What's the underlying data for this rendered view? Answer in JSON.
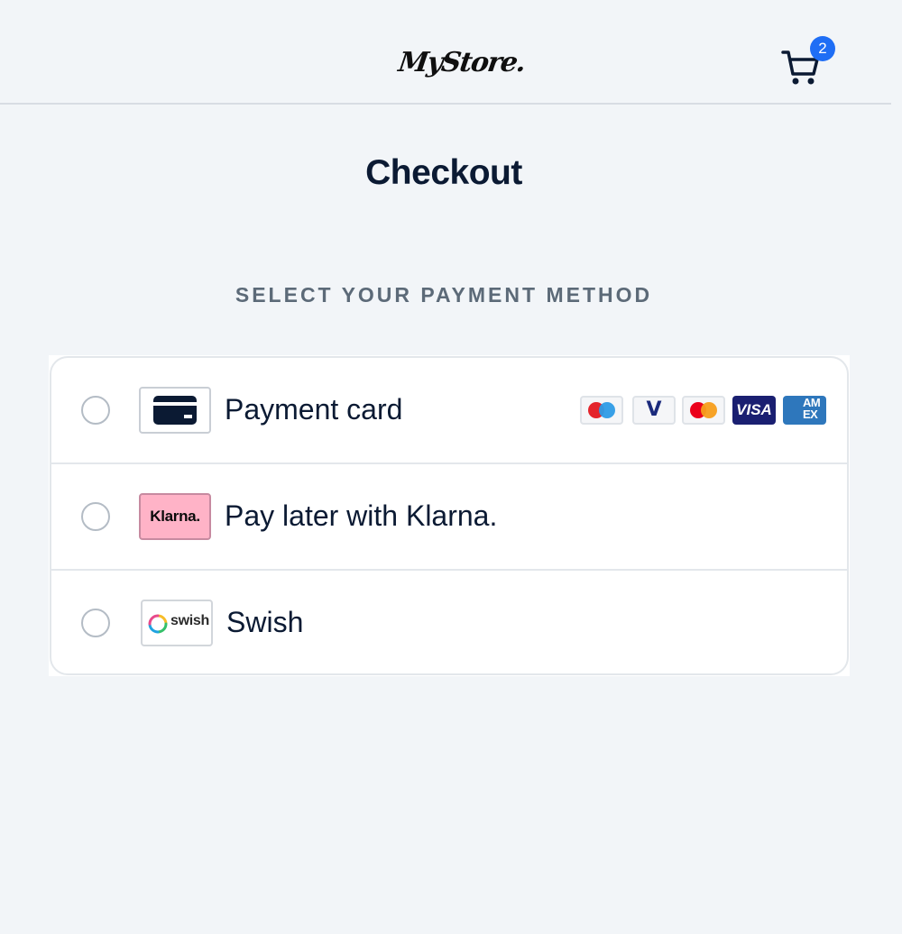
{
  "header": {
    "logo_text": "MyStore.",
    "cart": {
      "icon": "cart-icon",
      "count": "2"
    }
  },
  "page": {
    "title": "Checkout",
    "section_heading": "SELECT YOUR PAYMENT METHOD"
  },
  "payment_methods": [
    {
      "label": "Payment card",
      "icon": "credit-card-icon",
      "selected": false,
      "brands": [
        {
          "name": "Maestro",
          "icon": "maestro-icon"
        },
        {
          "name": "V",
          "icon": "vpay-icon"
        },
        {
          "name": "Mastercard",
          "icon": "mastercard-icon"
        },
        {
          "name": "VISA",
          "icon": "visa-icon"
        },
        {
          "name": "AM EX",
          "icon": "amex-icon"
        }
      ]
    },
    {
      "label": "Pay later with Klarna.",
      "icon": "klarna-icon",
      "icon_text": "Klarna.",
      "selected": false
    },
    {
      "label": "Swish",
      "icon": "swish-icon",
      "icon_text": "swish",
      "selected": false
    }
  ],
  "colors": {
    "background": "#f2f5f8",
    "text_primary": "#0b1a33",
    "heading_muted": "#5c6a78",
    "badge": "#1f6ef5",
    "klarna_pink": "#ffb3c7"
  }
}
